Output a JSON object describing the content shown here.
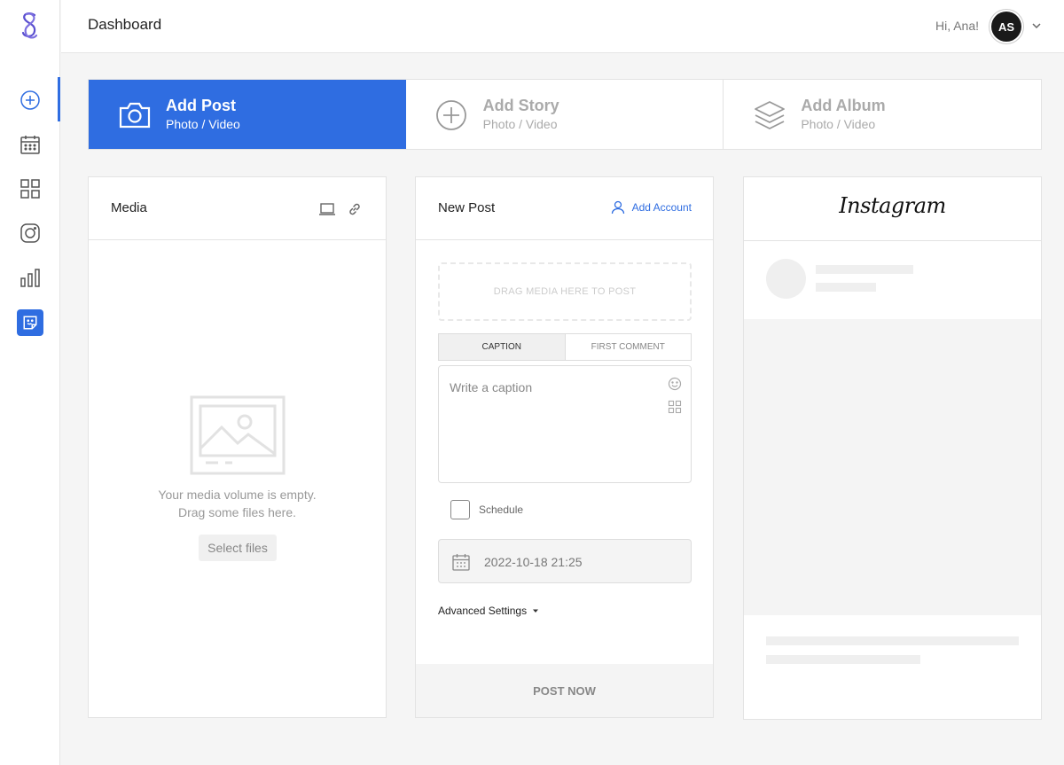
{
  "header": {
    "title": "Dashboard",
    "greeting": "Hi, Ana!",
    "avatar_initials": "AS"
  },
  "sidebar": {
    "items": [
      {
        "name": "add",
        "icon": "plus-circle-icon"
      },
      {
        "name": "calendar",
        "icon": "calendar-icon"
      },
      {
        "name": "grid",
        "icon": "grid-icon"
      },
      {
        "name": "instagram",
        "icon": "instagram-icon"
      },
      {
        "name": "analytics",
        "icon": "bar-chart-icon"
      },
      {
        "name": "sticker",
        "icon": "sticker-icon"
      }
    ]
  },
  "tabs": [
    {
      "title": "Add Post",
      "subtitle": "Photo / Video",
      "icon": "camera-icon",
      "active": true
    },
    {
      "title": "Add Story",
      "subtitle": "Photo / Video",
      "icon": "plus-circle-icon",
      "active": false
    },
    {
      "title": "Add Album",
      "subtitle": "Photo / Video",
      "icon": "layers-icon",
      "active": false
    }
  ],
  "media": {
    "title": "Media",
    "empty_line1": "Your media volume is empty.",
    "empty_line2": "Drag some files here.",
    "select_files": "Select files"
  },
  "new_post": {
    "title": "New Post",
    "add_account": "Add Account",
    "drop_zone": "DRAG MEDIA HERE TO POST",
    "caption_tab": "CAPTION",
    "first_comment_tab": "FIRST COMMENT",
    "caption_placeholder": "Write a caption",
    "schedule_label": "Schedule",
    "date_value": "2022-10-18 21:25",
    "advanced_settings": "Advanced Settings",
    "post_now": "POST NOW"
  },
  "preview": {
    "logo_text": "Instagram"
  },
  "colors": {
    "accent": "#2f6de1",
    "border": "#e3e3e3",
    "placeholder": "#efefef"
  }
}
